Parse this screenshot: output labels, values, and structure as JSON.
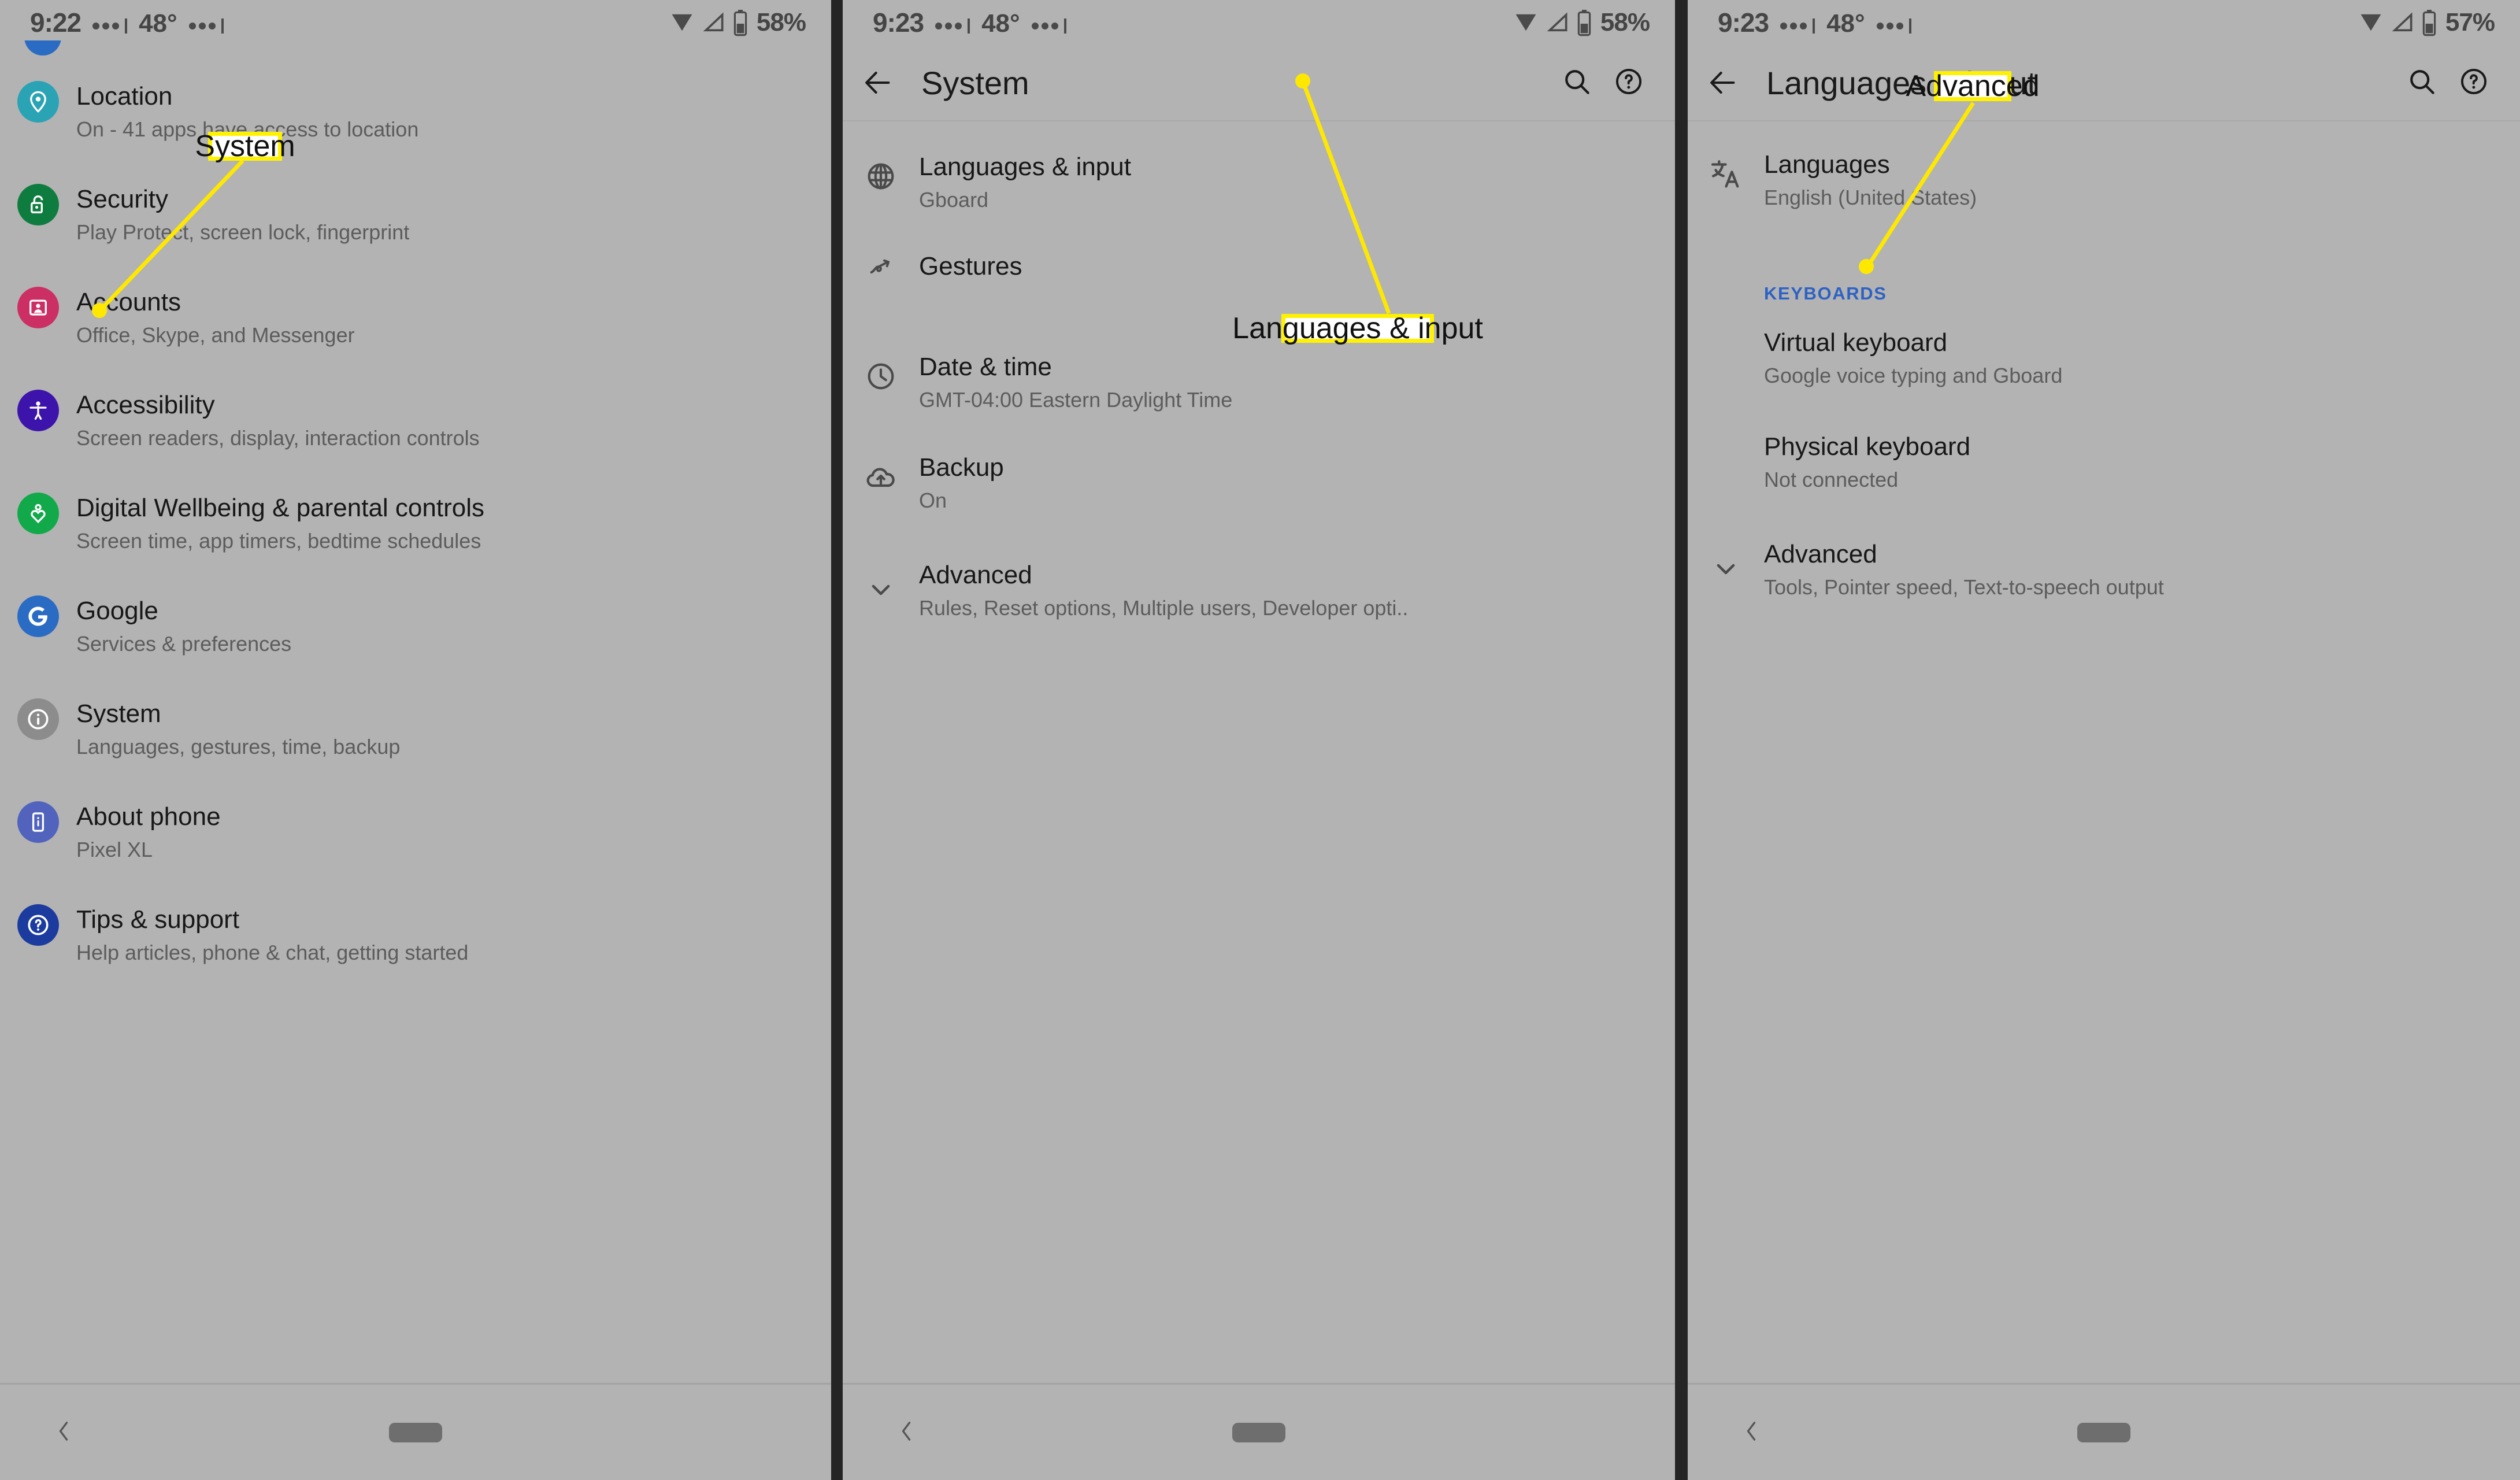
{
  "panels": [
    {
      "id": "settings-main",
      "status": {
        "time": "9:22",
        "temperature": "48°",
        "battery": "58%"
      },
      "appbar": {
        "title": "",
        "has_appbar": false
      },
      "items": [
        {
          "title": "Location",
          "subtitle": "On - 41 apps have access to location",
          "icon": "location-pin-icon",
          "color": "#2aa3b5"
        },
        {
          "title": "Security",
          "subtitle": "Play Protect, screen lock, fingerprint",
          "icon": "lock-open-icon",
          "color": "#0f7c3f"
        },
        {
          "title": "Accounts",
          "subtitle": "Office, Skype, and Messenger",
          "icon": "account-card-icon",
          "color": "#cc2f63"
        },
        {
          "title": "Accessibility",
          "subtitle": "Screen readers, display, interaction controls",
          "icon": "accessibility-person-icon",
          "color": "#3d14ab"
        },
        {
          "title": "Digital Wellbeing & parental controls",
          "subtitle": "Screen time, app timers, bedtime schedules",
          "icon": "wellbeing-heart-icon",
          "color": "#11a94a"
        },
        {
          "title": "Google",
          "subtitle": "Services & preferences",
          "icon": "google-g-icon",
          "color": "#2a6bc4"
        },
        {
          "title": "System",
          "subtitle": "Languages, gestures, time, backup",
          "icon": "info-circle-icon",
          "color": "#8c8c8c"
        },
        {
          "title": "About phone",
          "subtitle": "Pixel XL",
          "icon": "phone-info-icon",
          "color": "#5163bd"
        },
        {
          "title": "Tips & support",
          "subtitle": "Help articles, phone & chat, getting started",
          "icon": "question-circle-icon",
          "color": "#1b3c9e"
        }
      ],
      "navbar": {
        "back": "nav-back-icon",
        "home": "nav-home-pill"
      }
    },
    {
      "id": "system",
      "status": {
        "time": "9:23",
        "temperature": "48°",
        "battery": "58%"
      },
      "appbar": {
        "title": "System",
        "has_appbar": true,
        "back": "back-arrow-icon",
        "search": "search-icon",
        "help": "help-circle-icon"
      },
      "items": [
        {
          "title": "Languages & input",
          "subtitle": "Gboard",
          "icon": "globe-icon"
        },
        {
          "title": "Gestures",
          "subtitle": "",
          "icon": "gesture-swipe-icon"
        },
        {
          "title": "Date & time",
          "subtitle": "GMT-04:00 Eastern Daylight Time",
          "icon": "clock-icon"
        },
        {
          "title": "Backup",
          "subtitle": "On",
          "icon": "cloud-upload-icon"
        },
        {
          "title": "Advanced",
          "subtitle": "Rules, Reset options, Multiple users, Developer opti..",
          "icon": "chevron-down-icon"
        }
      ],
      "navbar": {
        "back": "nav-back-icon",
        "home": "nav-home-pill"
      }
    },
    {
      "id": "languages-and-input",
      "status": {
        "time": "9:23",
        "temperature": "48°",
        "battery": "57%"
      },
      "appbar": {
        "title": "Languages & input",
        "has_appbar": true,
        "back": "back-arrow-icon",
        "search": "search-icon",
        "help": "help-circle-icon"
      },
      "items": [
        {
          "title": "Languages",
          "subtitle": "English (United States)",
          "icon": "translate-icon"
        }
      ],
      "section_header": "KEYBOARDS",
      "keyboard_items": [
        {
          "title": "Virtual keyboard",
          "subtitle": "Google voice typing and Gboard",
          "icon": ""
        },
        {
          "title": "Physical keyboard",
          "subtitle": "Not connected",
          "icon": ""
        },
        {
          "title": "Advanced",
          "subtitle": "Tools, Pointer speed, Text-to-speech output",
          "icon": "chevron-down-icon"
        }
      ],
      "navbar": {
        "back": "nav-back-icon",
        "home": "nav-home-pill"
      }
    }
  ],
  "callouts": [
    {
      "label": "System",
      "target": "Google row in Settings list"
    },
    {
      "label": "Languages & input",
      "target": "Languages & input row in System list"
    },
    {
      "label": "Advanced",
      "target": "Advanced row in Languages & input list"
    }
  ],
  "colors": {
    "background": "#b3b3b3",
    "divider": "#242424",
    "callout_border": "#fff200",
    "callout_fill": "#ffffff",
    "section_header": "#2d62c4",
    "primary_text": "#171717",
    "secondary_text": "#5c5c5c"
  }
}
